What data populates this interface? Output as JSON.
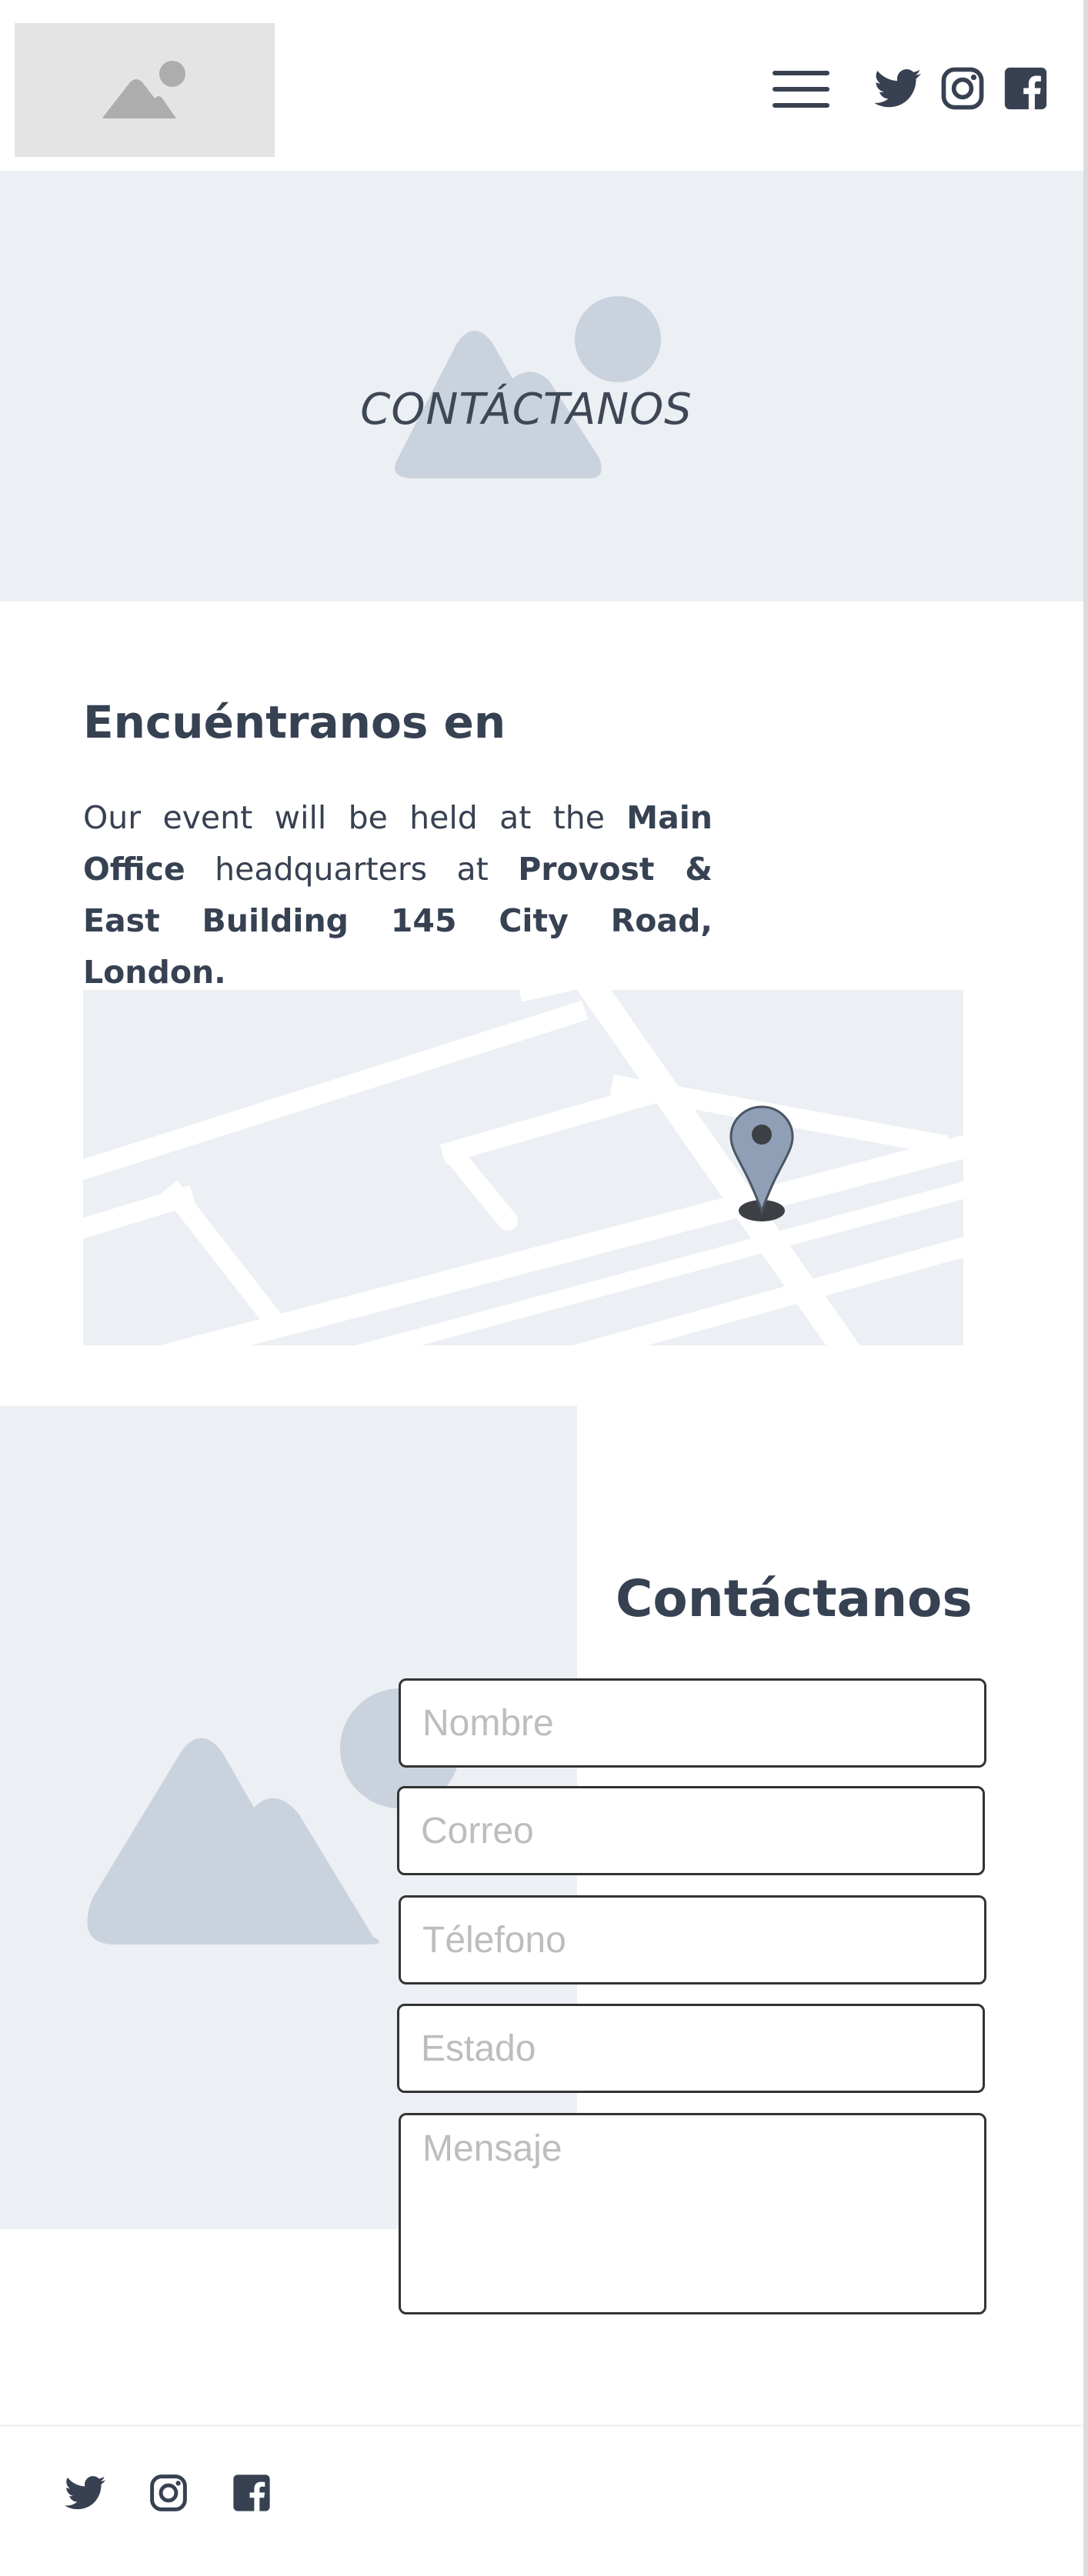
{
  "header": {
    "logo": "image-placeholder-icon",
    "menu_icon": "hamburger-menu-icon",
    "social": [
      "twitter-icon",
      "instagram-icon",
      "facebook-icon"
    ]
  },
  "hero": {
    "title": "CONTÁCTANOS"
  },
  "find_us": {
    "heading": "Encuéntranos en",
    "text": {
      "t1": "Our event will be held at the ",
      "b1": "Main Office",
      "t2": " headquarters at ",
      "b2": "Provost & East Building 145 City Road, London."
    }
  },
  "map": {
    "marker": "map-pin-icon"
  },
  "contact": {
    "heading": "Contáctanos",
    "fields": {
      "name": {
        "placeholder": "Nombre",
        "value": ""
      },
      "email": {
        "placeholder": "Correo",
        "value": ""
      },
      "phone": {
        "placeholder": "Télefono",
        "value": ""
      },
      "state": {
        "placeholder": "Estado",
        "value": ""
      },
      "message": {
        "placeholder": "Mensaje",
        "value": ""
      }
    }
  },
  "footer": {
    "social": [
      "twitter-icon",
      "instagram-icon",
      "facebook-icon"
    ]
  },
  "colors": {
    "text_dark": "#364152",
    "placeholder_bg": "#eceff3",
    "placeholder_shape": "#c9d2dd",
    "marker": "#8f9fb5"
  }
}
